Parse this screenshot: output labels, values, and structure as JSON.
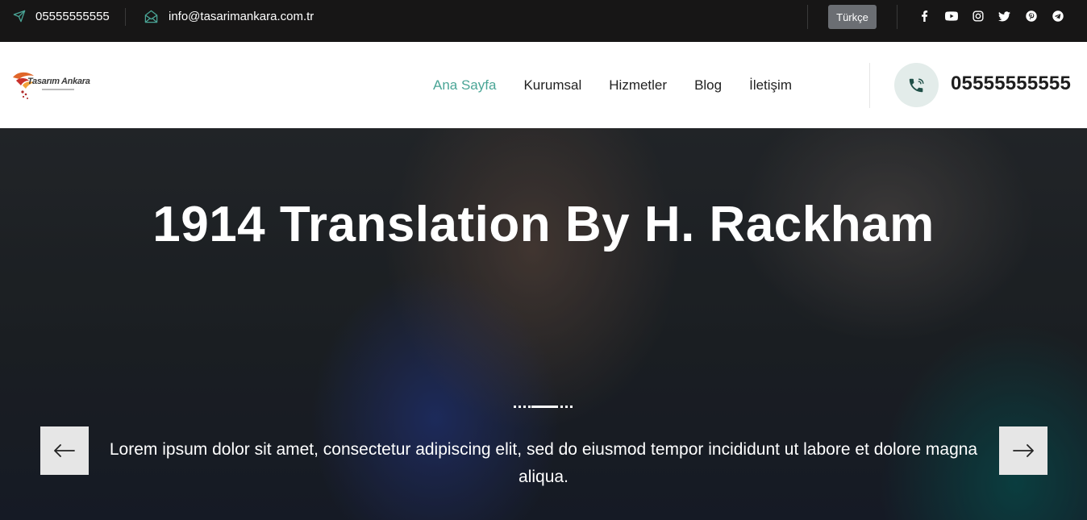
{
  "topbar": {
    "phone": "05555555555",
    "email": "info@tasarimankara.com.tr",
    "language": "Türkçe",
    "social_icons": [
      "facebook-icon",
      "youtube-icon",
      "instagram-icon",
      "twitter-icon",
      "pinterest-icon",
      "telegram-icon"
    ]
  },
  "header": {
    "logo_text": "Tasarım Ankara",
    "nav": [
      {
        "label": "Ana Sayfa",
        "active": true
      },
      {
        "label": "Kurumsal",
        "active": false
      },
      {
        "label": "Hizmetler",
        "active": false
      },
      {
        "label": "Blog",
        "active": false
      },
      {
        "label": "İletişim",
        "active": false
      }
    ],
    "call_number": "05555555555"
  },
  "hero": {
    "title": "1914 Translation By H. Rackham",
    "text": "Lorem ipsum dolor sit amet, consectetur adipiscing elit, sed do eiusmod tempor incididunt ut labore et dolore magna aliqua."
  },
  "colors": {
    "topbar_bg": "#171616",
    "accent": "#4aa596",
    "dark_text": "#1e1e1e",
    "lang_button_bg": "#6b6e73"
  }
}
